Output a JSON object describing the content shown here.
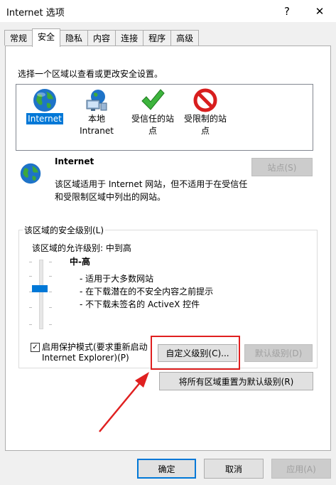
{
  "window": {
    "title": "Internet 选项",
    "help": "?",
    "close": "✕"
  },
  "tabs": [
    {
      "label": "常规"
    },
    {
      "label": "安全"
    },
    {
      "label": "隐私"
    },
    {
      "label": "内容"
    },
    {
      "label": "连接"
    },
    {
      "label": "程序"
    },
    {
      "label": "高级"
    }
  ],
  "security": {
    "prompt": "选择一个区域以查看或更改安全设置。",
    "zones": [
      {
        "line1": "Internet",
        "line2": "",
        "icon": "globe-icon"
      },
      {
        "line1": "本地",
        "line2": "Intranet",
        "icon": "local-intranet-icon"
      },
      {
        "line1": "受信任的站",
        "line2": "点",
        "icon": "checkmark-icon"
      },
      {
        "line1": "受限制的站",
        "line2": "点",
        "icon": "restricted-icon"
      }
    ],
    "zone_title": "Internet",
    "zone_desc_line1": "该区域适用于 Internet 网站，但不适用于在受信任",
    "zone_desc_line2": "和受限制区域中列出的网站。",
    "sites_button": "站点(S)"
  },
  "level": {
    "group_label": "该区域的安全级别(L)",
    "allowed": "该区域的允许级别: 中到高",
    "level_name": "中-高",
    "bullets": [
      "- 适用于大多数网站",
      "- 在下载潜在的不安全内容之前提示",
      "- 不下载未签名的 ActiveX 控件"
    ],
    "slider_level": 0.4,
    "protected_mode_line1": "启用保护模式(要求重新启动",
    "protected_mode_line2": "Internet Explorer)(P)",
    "protected_mode_checked": true,
    "check_glyph": "✓",
    "custom_button": "自定义级别(C)...",
    "default_button": "默认级别(D)",
    "reset_all_button": "将所有区域重置为默认级别(R)"
  },
  "footer": {
    "ok": "确定",
    "cancel": "取消",
    "apply": "应用(A)"
  },
  "colors": {
    "accent": "#0078d7",
    "annotation": "#e02020"
  }
}
